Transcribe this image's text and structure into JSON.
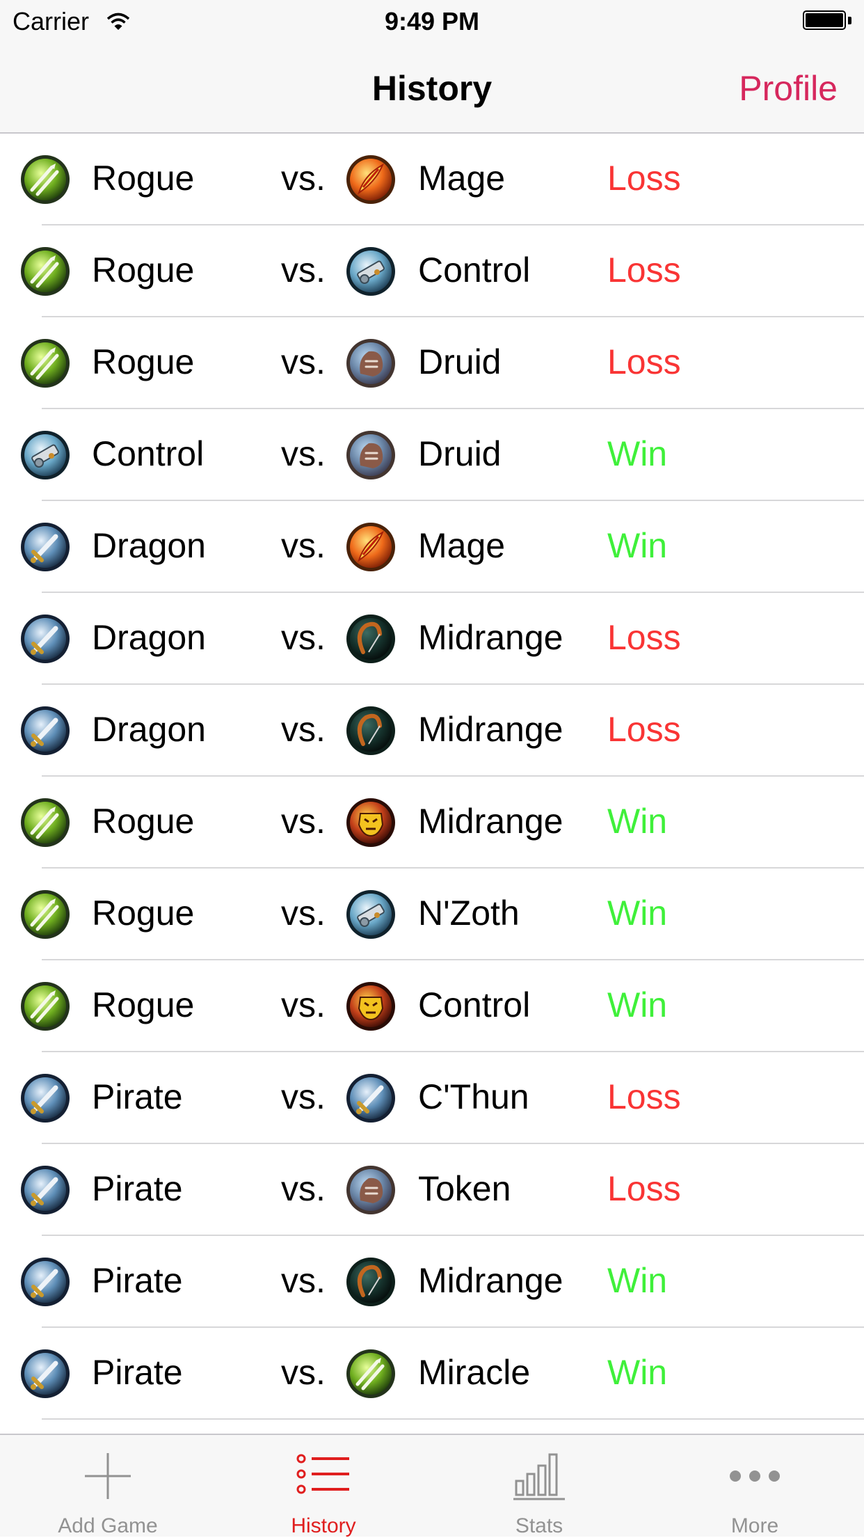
{
  "status_bar": {
    "carrier": "Carrier",
    "time": "9:49 PM"
  },
  "nav": {
    "title": "History",
    "right_button": "Profile"
  },
  "rows": [
    {
      "player": "Rogue",
      "player_icon": "rogue-icon",
      "vs": "vs.",
      "opponent": "Mage",
      "opponent_icon": "mage-icon",
      "result": "Loss"
    },
    {
      "player": "Rogue",
      "player_icon": "rogue-icon",
      "vs": "vs.",
      "opponent": "Control",
      "opponent_icon": "cannon-icon",
      "result": "Loss"
    },
    {
      "player": "Rogue",
      "player_icon": "rogue-icon",
      "vs": "vs.",
      "opponent": "Druid",
      "opponent_icon": "druid-icon",
      "result": "Loss"
    },
    {
      "player": "Control",
      "player_icon": "cannon-icon",
      "vs": "vs.",
      "opponent": "Druid",
      "opponent_icon": "druid-icon",
      "result": "Win"
    },
    {
      "player": "Dragon",
      "player_icon": "sword-icon",
      "vs": "vs.",
      "opponent": "Mage",
      "opponent_icon": "mage-icon",
      "result": "Win"
    },
    {
      "player": "Dragon",
      "player_icon": "sword-icon",
      "vs": "vs.",
      "opponent": "Midrange",
      "opponent_icon": "bow-icon",
      "result": "Loss"
    },
    {
      "player": "Dragon",
      "player_icon": "sword-icon",
      "vs": "vs.",
      "opponent": "Midrange",
      "opponent_icon": "bow-icon",
      "result": "Loss"
    },
    {
      "player": "Rogue",
      "player_icon": "rogue-icon",
      "vs": "vs.",
      "opponent": "Midrange",
      "opponent_icon": "warlock-icon",
      "result": "Win"
    },
    {
      "player": "Rogue",
      "player_icon": "rogue-icon",
      "vs": "vs.",
      "opponent": "N'Zoth",
      "opponent_icon": "cannon-icon",
      "result": "Win"
    },
    {
      "player": "Rogue",
      "player_icon": "rogue-icon",
      "vs": "vs.",
      "opponent": "Control",
      "opponent_icon": "warlock-icon",
      "result": "Win"
    },
    {
      "player": "Pirate",
      "player_icon": "sword-icon",
      "vs": "vs.",
      "opponent": "C'Thun",
      "opponent_icon": "sword-icon",
      "result": "Loss"
    },
    {
      "player": "Pirate",
      "player_icon": "sword-icon",
      "vs": "vs.",
      "opponent": "Token",
      "opponent_icon": "druid-icon",
      "result": "Loss"
    },
    {
      "player": "Pirate",
      "player_icon": "sword-icon",
      "vs": "vs.",
      "opponent": "Midrange",
      "opponent_icon": "bow-icon",
      "result": "Win"
    },
    {
      "player": "Pirate",
      "player_icon": "sword-icon",
      "vs": "vs.",
      "opponent": "Miracle",
      "opponent_icon": "rogue-icon",
      "result": "Win"
    }
  ],
  "tab_bar": {
    "tabs": [
      {
        "label": "Add Game",
        "icon": "plus-icon",
        "active": false
      },
      {
        "label": "History",
        "icon": "list-icon",
        "active": true
      },
      {
        "label": "Stats",
        "icon": "bar-chart-icon",
        "active": false
      },
      {
        "label": "More",
        "icon": "more-icon",
        "active": false
      }
    ]
  },
  "colors": {
    "tint": "#d6275d",
    "win": "#3ff03a",
    "loss": "#f93434",
    "tab_active": "#e01e1e",
    "tab_inactive": "#929292"
  }
}
